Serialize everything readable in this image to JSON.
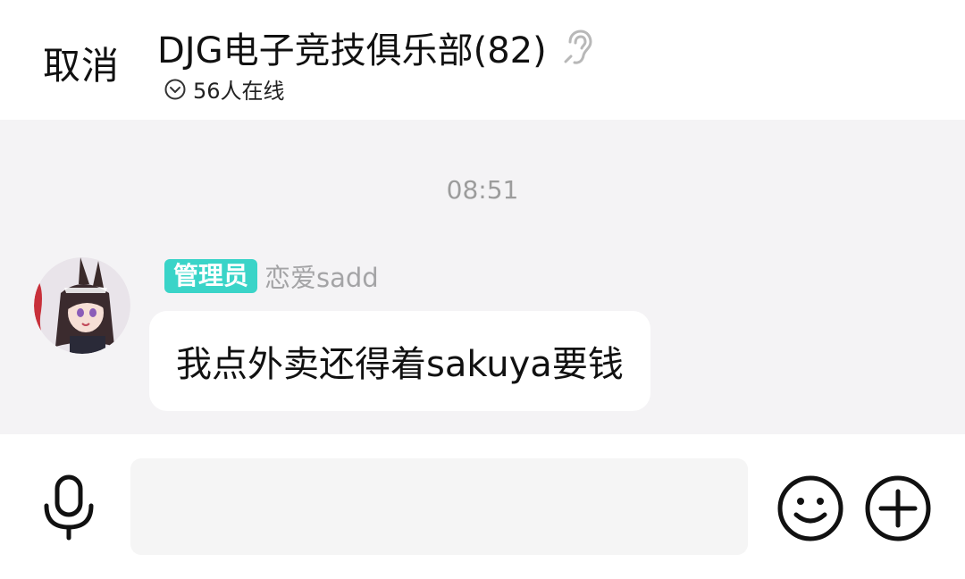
{
  "header": {
    "cancel_label": "取消",
    "title": "DJG电子竞技俱乐部(82)",
    "online_text": "56人在线"
  },
  "chat": {
    "timestamp": "08:51",
    "messages": [
      {
        "role_badge": "管理员",
        "sender": "恋爱sadd",
        "text": "我点外卖还得着sakuya要钱"
      }
    ]
  },
  "input": {
    "placeholder": ""
  },
  "icons": {
    "ear": "ear-icon",
    "online": "chevron-circle-icon",
    "mic": "microphone-icon",
    "emoji": "smiley-icon",
    "plus": "plus-circle-icon"
  },
  "colors": {
    "admin_badge": "#3ad4c8",
    "chat_background": "#f4f3f5",
    "bubble": "#ffffff",
    "timestamp": "#9c9c9c",
    "sender_name": "#a4a4a6"
  }
}
